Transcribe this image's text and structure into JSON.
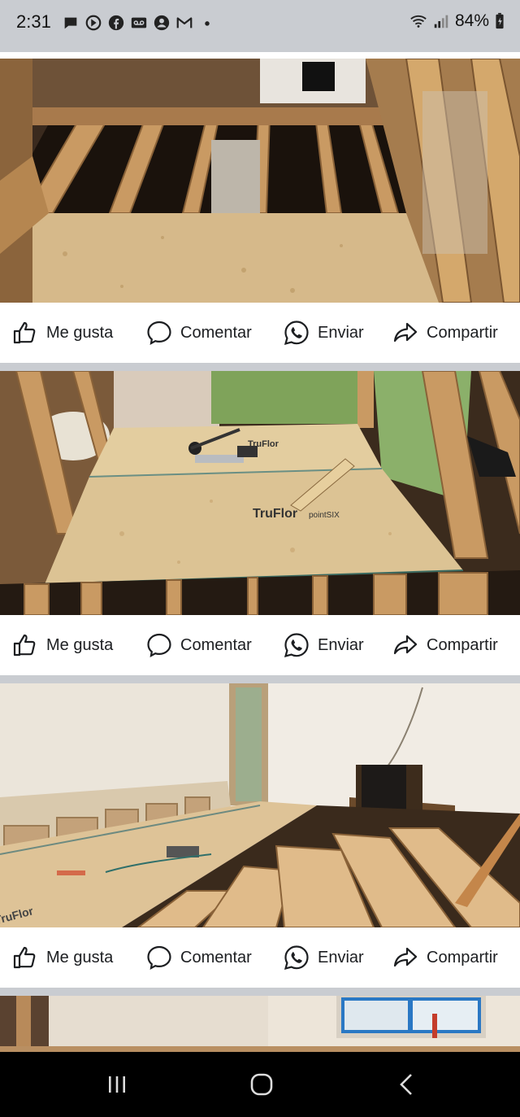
{
  "status_bar": {
    "time": "2:31",
    "notification_icons": [
      "chat-icon",
      "video-play-icon",
      "facebook-icon",
      "voicemail-icon",
      "account-icon",
      "mail-icon",
      "dot-icon"
    ],
    "battery_percent": "84%"
  },
  "posts": [
    {
      "image_alt": "Subfloor OSB installed over exposed floor joists with wall studs"
    },
    {
      "image_alt": "TruFlor OSB subfloor panels with flooring tools in room with green walls"
    },
    {
      "image_alt": "Room with open floor joists and partially laid TruFlor subfloor panels"
    },
    {
      "image_alt": "Room with window, partially visible"
    }
  ],
  "actions": {
    "like": "Me gusta",
    "comment": "Comentar",
    "send": "Enviar",
    "share": "Compartir"
  },
  "photo_labels": {
    "brand_a": "TruFlor",
    "brand_b": "pointSIX"
  },
  "colors": {
    "background": "#c9ccd1",
    "card": "#ffffff",
    "text": "#1c1e21",
    "nav": "#000000"
  }
}
